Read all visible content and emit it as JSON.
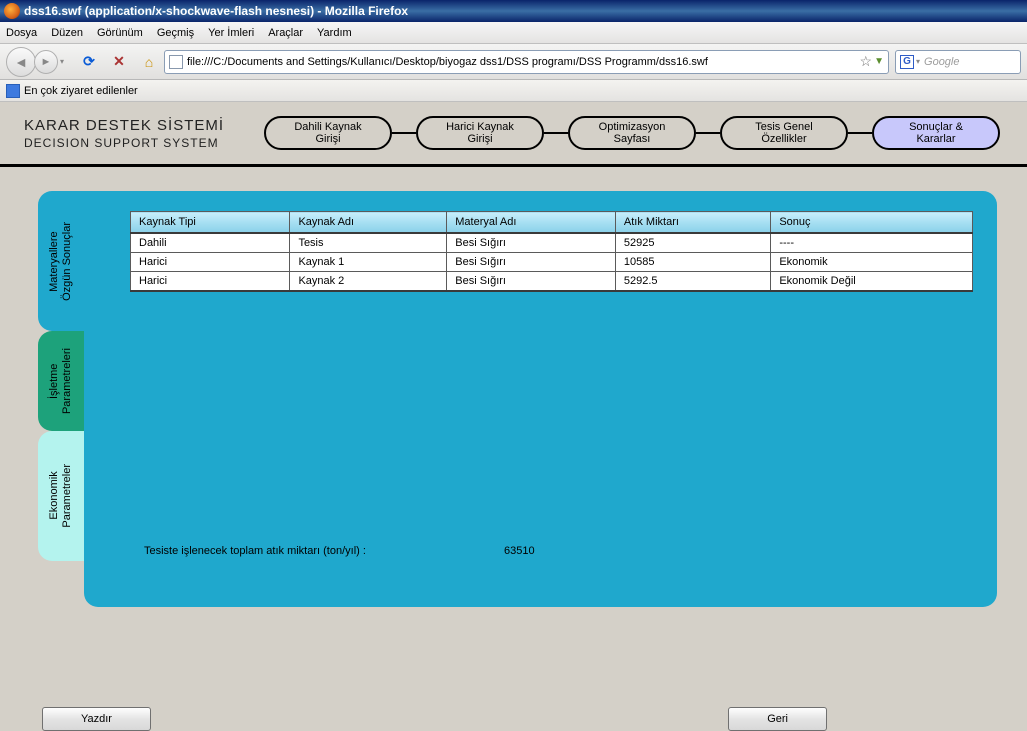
{
  "window": {
    "title": "dss16.swf (application/x-shockwave-flash nesnesi) - Mozilla Firefox"
  },
  "menu": {
    "file": "Dosya",
    "edit": "Düzen",
    "view": "Görünüm",
    "history": "Geçmiş",
    "bookmarks": "Yer İmleri",
    "tools": "Araçlar",
    "help": "Yardım"
  },
  "toolbar": {
    "url": "file:///C:/Documents and Settings/Kullanıcı/Desktop/biyogaz dss1/DSS programı/DSS Programm/dss16.swf",
    "search_engine_letter": "G",
    "search_placeholder": "Google"
  },
  "bookmarks_bar": {
    "most_visited": "En çok ziyaret edilenler"
  },
  "app": {
    "title_tr": "KARAR DESTEK SİSTEMİ",
    "title_en": "DECISION SUPPORT SYSTEM",
    "nav": {
      "p1a": "Dahili Kaynak",
      "p1b": "Girişi",
      "p2a": "Harici Kaynak",
      "p2b": "Girişi",
      "p3a": "Optimizasyon",
      "p3b": "Sayfası",
      "p4a": "Tesis Genel",
      "p4b": "Özellikler",
      "p5a": "Sonuçlar &",
      "p5b": "Kararlar"
    }
  },
  "side_tabs": {
    "a1": "Materyallere",
    "a2": "Özgün Sonuçlar",
    "b1": "İşletme",
    "b2": "Parametreleri",
    "c1": "Ekonomik",
    "c2": "Parametreler"
  },
  "table": {
    "headers": {
      "h1": "Kaynak Tipi",
      "h2": "Kaynak Adı",
      "h3": "Materyal Adı",
      "h4": "Atık Miktarı",
      "h5": "Sonuç"
    },
    "rows": [
      {
        "c1": "Dahili",
        "c2": "Tesis",
        "c3": "Besi Sığırı",
        "c4": "52925",
        "c5": "----"
      },
      {
        "c1": "Harici",
        "c2": "Kaynak 1",
        "c3": "Besi Sığırı",
        "c4": "10585",
        "c5": "Ekonomik"
      },
      {
        "c1": "Harici",
        "c2": "Kaynak 2",
        "c3": "Besi Sığırı",
        "c4": "5292.5",
        "c5": "Ekonomik Değil"
      }
    ]
  },
  "summary": {
    "label": "Tesiste işlenecek toplam atık miktarı  (ton/yıl) :",
    "value": "63510"
  },
  "buttons": {
    "print": "Yazdır",
    "back": "Geri"
  }
}
